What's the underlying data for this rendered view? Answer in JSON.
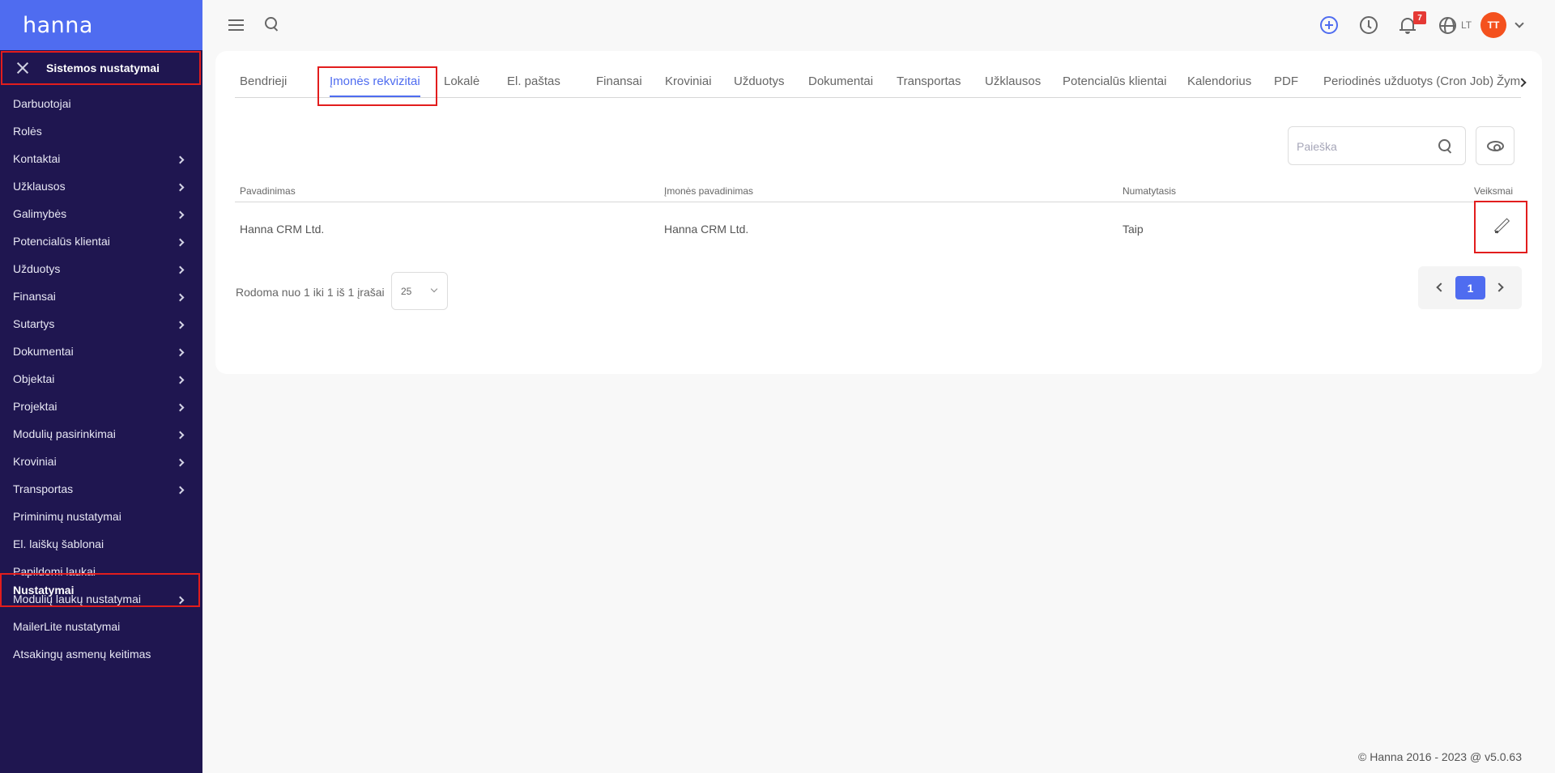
{
  "app": {
    "logo": "hanna"
  },
  "sidebar": {
    "header": "Sistemos nustatymai",
    "items": [
      {
        "label": "Darbuotojai",
        "has_children": false
      },
      {
        "label": "Rolės",
        "has_children": false
      },
      {
        "label": "Kontaktai",
        "has_children": true
      },
      {
        "label": "Užklausos",
        "has_children": true
      },
      {
        "label": "Galimybės",
        "has_children": true
      },
      {
        "label": "Potencialūs klientai",
        "has_children": true
      },
      {
        "label": "Užduotys",
        "has_children": true
      },
      {
        "label": "Finansai",
        "has_children": true
      },
      {
        "label": "Sutartys",
        "has_children": true
      },
      {
        "label": "Dokumentai",
        "has_children": true
      },
      {
        "label": "Objektai",
        "has_children": true
      },
      {
        "label": "Projektai",
        "has_children": true
      },
      {
        "label": "Modulių pasirinkimai",
        "has_children": true
      },
      {
        "label": "Kroviniai",
        "has_children": true
      },
      {
        "label": "Transportas",
        "has_children": true
      },
      {
        "label": "Priminimų nustatymai",
        "has_children": false
      },
      {
        "label": "El. laiškų šablonai",
        "has_children": false
      },
      {
        "label": "Papildomi laukai",
        "has_children": false
      },
      {
        "label": "Modulių laukų nustatymai",
        "has_children": true
      },
      {
        "label": "MailerLite nustatymai",
        "has_children": false
      },
      {
        "label": "Atsakingų asmenų keitimas",
        "has_children": false
      }
    ],
    "active_item": "Nustatymai"
  },
  "topbar": {
    "notifications_count": "7",
    "language": "LT",
    "avatar_initials": "TT",
    "icons": [
      "hamburger-icon",
      "search-icon",
      "plus-circle-icon",
      "clock-icon",
      "bell-icon",
      "globe-icon",
      "chevron-down-icon"
    ]
  },
  "tabs": {
    "items": [
      "Bendrieji",
      "Įmonės rekvizitai",
      "Lokalė",
      "El. paštas",
      "Finansai",
      "Kroviniai",
      "Užduotys",
      "Dokumentai",
      "Transportas",
      "Užklausos",
      "Potencialūs klientai",
      "Kalendorius",
      "PDF",
      "Periodinės užduotys (Cron Job)",
      "Žymės"
    ],
    "active_index": 1
  },
  "search": {
    "placeholder": "Paieška",
    "value": ""
  },
  "table": {
    "columns": [
      "Pavadinimas",
      "Įmonės pavadinimas",
      "Numatytasis",
      "Veiksmai"
    ],
    "rows": [
      {
        "name": "Hanna CRM Ltd.",
        "company_name": "Hanna CRM Ltd.",
        "default": "Taip"
      }
    ]
  },
  "footer": {
    "info": "Rodoma nuo 1 iki 1 iš 1 įrašai",
    "page_size": "25",
    "current_page": "1"
  },
  "copyright": "© Hanna 2016 - 2023 @ v5.0.63",
  "colors": {
    "sidebar_bg": "#1f1650",
    "accent": "#4f6cf0",
    "highlight": "#e21d1d",
    "avatar": "#f4511e",
    "badge": "#e53935"
  }
}
